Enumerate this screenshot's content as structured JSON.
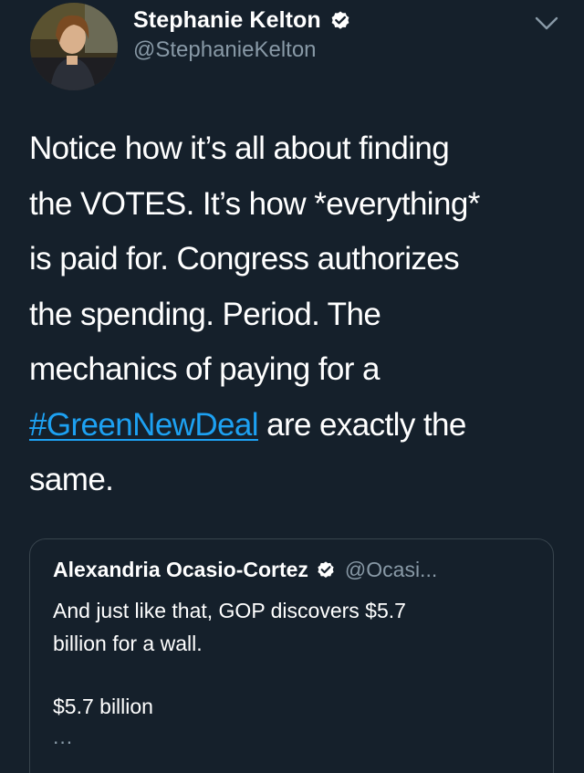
{
  "tweet": {
    "author": {
      "name": "Stephanie Kelton",
      "handle": "@StephanieKelton",
      "verified": true,
      "avatar_icon": "profile-photo"
    },
    "menu_icon": "chevron-down-icon",
    "text_lines": [
      "Notice how it’s all about finding",
      "the VOTES. It’s how *everything*",
      "is paid for. Congress authorizes",
      "the spending. Period. The",
      "mechanics of paying for a",
      "are exactly the",
      "same."
    ],
    "hashtag": "#GreenNewDeal"
  },
  "quoted_tweet": {
    "author_name": "Alexandria Ocasio-Cortez",
    "author_handle": "@Ocasi...",
    "verified": true,
    "text_lines": [
      "And just like that, GOP discovers $5.7",
      "billion for a wall."
    ],
    "extra_line": "$5.7 billion",
    "ellipsis": "..."
  },
  "colors": {
    "background": "#15202b",
    "text": "#ffffff",
    "secondary_text": "#8899a6",
    "link": "#1da1f2",
    "card_border": "#38444d"
  }
}
